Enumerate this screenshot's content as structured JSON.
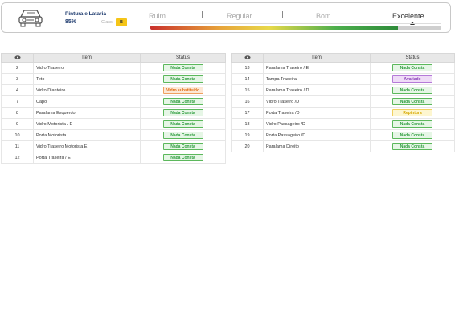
{
  "header": {
    "category": "Pintura e Lataria",
    "percent": "85%",
    "class_label": "Class:",
    "class_value": "B",
    "car_icon": "car-front-icon",
    "scale": {
      "levels": [
        "Ruim",
        "Regular",
        "Bom",
        "Excelente"
      ],
      "selected": "Excelente",
      "level_value": 0.85
    }
  },
  "status_colors": {
    "Nada Consta": {
      "fg": "#2e9d3e",
      "bg": "#e6f6e6",
      "border": "#5cb85c"
    },
    "Vidro substituído": {
      "fg": "#e06a10",
      "bg": "#fde8d6",
      "border": "#f0a060"
    },
    "Avariado": {
      "fg": "#8a3fb8",
      "bg": "#efdcf7",
      "border": "#b57ad8"
    },
    "Repintura": {
      "fg": "#d6a800",
      "bg": "#fdf6d0",
      "border": "#f0d060"
    }
  },
  "tables": [
    {
      "columns": {
        "icon": "eye-icon",
        "item": "Item",
        "status": "Status"
      },
      "rows": [
        {
          "num": "2",
          "item": "Vidro Traseiro",
          "status": "Nada Consta"
        },
        {
          "num": "3",
          "item": "Teto",
          "status": "Nada Consta"
        },
        {
          "num": "4",
          "item": "Vidro Dianteiro",
          "status": "Vidro substituído"
        },
        {
          "num": "7",
          "item": "Capô",
          "status": "Nada Consta"
        },
        {
          "num": "8",
          "item": "Paralama Esquerdo",
          "status": "Nada Consta"
        },
        {
          "num": "9",
          "item": "Vidro Motorista / E",
          "status": "Nada Consta"
        },
        {
          "num": "10",
          "item": "Porta Motorista",
          "status": "Nada Consta"
        },
        {
          "num": "11",
          "item": "Vidro Traseiro Motorista E",
          "status": "Nada Consta"
        },
        {
          "num": "12",
          "item": "Porta Traseira / E",
          "status": "Nada Consta"
        }
      ]
    },
    {
      "columns": {
        "icon": "eye-icon",
        "item": "Item",
        "status": "Status"
      },
      "rows": [
        {
          "num": "13",
          "item": "Paralama Traseiro / E",
          "status": "Nada Consta"
        },
        {
          "num": "14",
          "item": "Tampa Traseira",
          "status": "Avariado"
        },
        {
          "num": "15",
          "item": "Paralama Traseiro / D",
          "status": "Nada Consta"
        },
        {
          "num": "16",
          "item": "Vidro Traseiro /D",
          "status": "Nada Consta"
        },
        {
          "num": "17",
          "item": "Porta Traseira /D",
          "status": "Repintura"
        },
        {
          "num": "18",
          "item": "Vidro Passageiro /D",
          "status": "Nada Consta"
        },
        {
          "num": "19",
          "item": "Porta Passageiro /D",
          "status": "Nada Consta"
        },
        {
          "num": "20",
          "item": "Paralama Direito",
          "status": "Nada Consta"
        }
      ]
    }
  ]
}
